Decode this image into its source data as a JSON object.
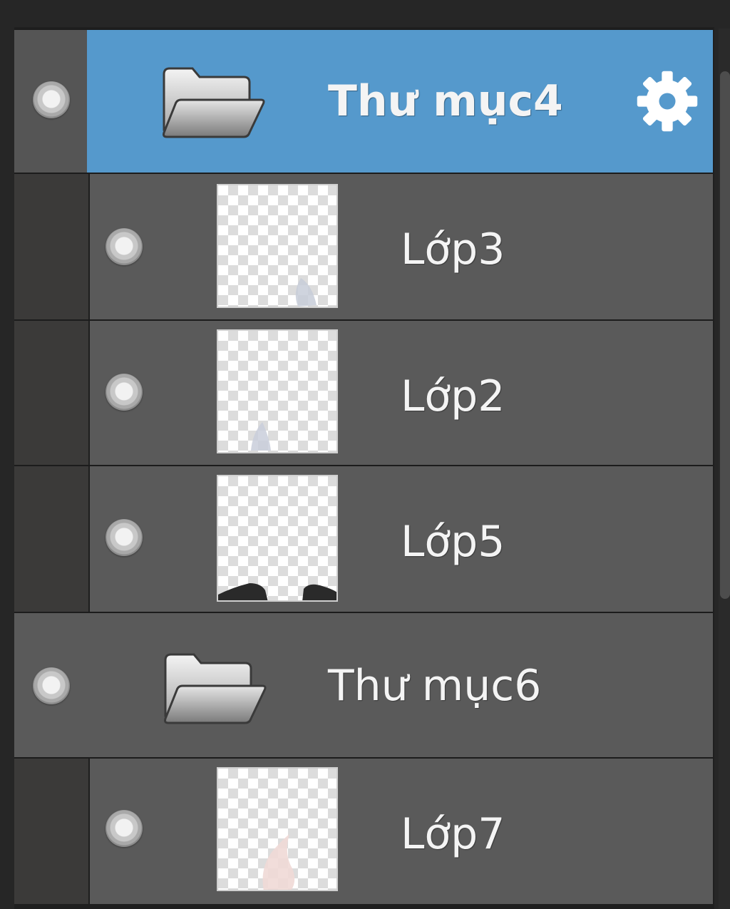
{
  "layers_panel": {
    "items": [
      {
        "type": "folder",
        "name": "Thư mục4",
        "selected": true,
        "visible": true,
        "settings_icon": "gear-icon"
      },
      {
        "type": "layer",
        "name": "Lớp3",
        "visible": true,
        "thumbnail": "transparent-layer-thumbnail"
      },
      {
        "type": "layer",
        "name": "Lớp2",
        "visible": true,
        "thumbnail": "transparent-layer-thumbnail"
      },
      {
        "type": "layer",
        "name": "Lớp5",
        "visible": true,
        "thumbnail": "transparent-layer-thumbnail"
      },
      {
        "type": "folder",
        "name": "Thư mục6",
        "selected": false,
        "visible": true
      },
      {
        "type": "layer",
        "name": "Lớp7",
        "visible": true,
        "thumbnail": "transparent-layer-thumbnail"
      }
    ]
  },
  "colors": {
    "selected_row": "#5599cc",
    "row": "#5a5a5a",
    "panel_background": "#262626",
    "label_text": "#f4f4f4"
  }
}
